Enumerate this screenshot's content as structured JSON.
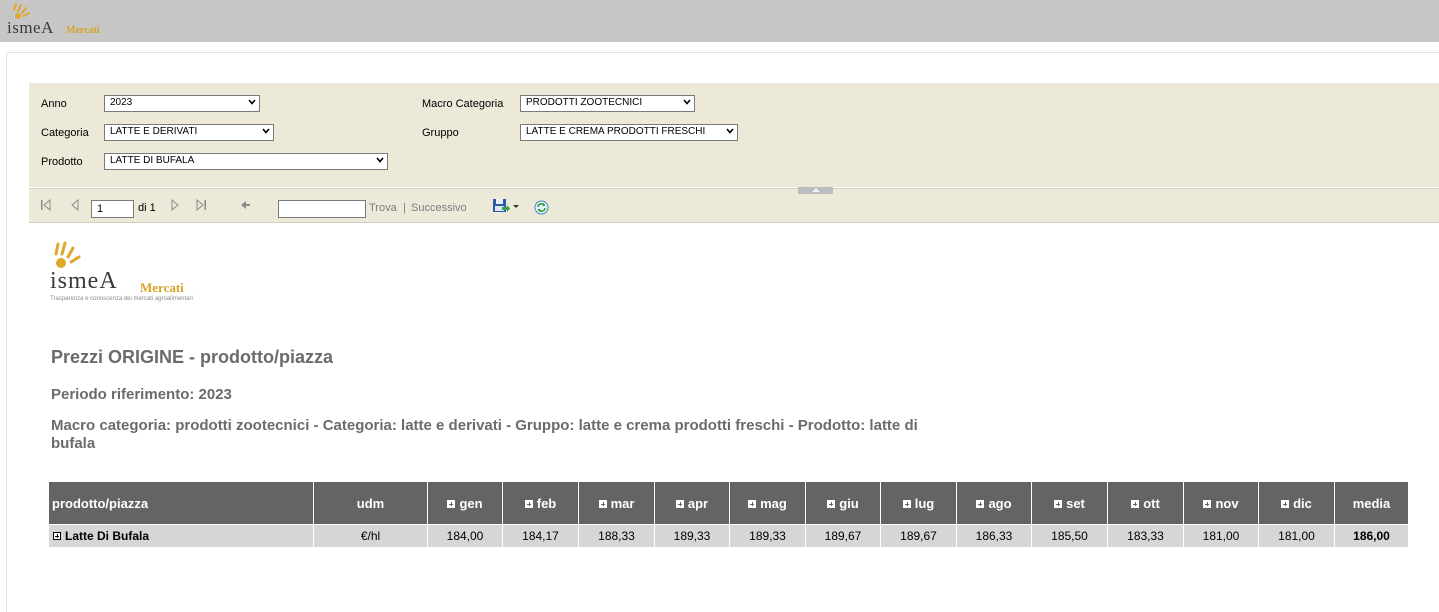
{
  "header": {
    "logo_brand": "ismeA",
    "logo_sub": "Mercati"
  },
  "params": {
    "anno_label": "Anno",
    "anno_value": "2023",
    "macro_label": "Macro Categoria",
    "macro_value": "PRODOTTI ZOOTECNICI",
    "categoria_label": "Categoria",
    "categoria_value": "LATTE E DERIVATI",
    "gruppo_label": "Gruppo",
    "gruppo_value": "LATTE E CREMA PRODOTTI FRESCHI",
    "prodotto_label": "Prodotto",
    "prodotto_value": "LATTE DI BUFALA"
  },
  "toolbar": {
    "page_value": "1",
    "page_of": "di 1",
    "find_label": "Trova",
    "separator": "|",
    "next_label": "Successivo"
  },
  "report": {
    "logo_brand": "ismeA",
    "logo_sub": "Mercati",
    "logo_tagline": "Trasparenza e conoscenza dei mercati agroalimentari",
    "title": "Prezzi ORIGINE - prodotto/piazza",
    "period": "Periodo riferimento: 2023",
    "description": "Macro categoria: prodotti zootecnici - Categoria: latte e derivati - Gruppo: latte e crema prodotti freschi - Prodotto: latte di bufala"
  },
  "table": {
    "col_product": "prodotto/piazza",
    "col_udm": "udm",
    "months": [
      "gen",
      "feb",
      "mar",
      "apr",
      "mag",
      "giu",
      "lug",
      "ago",
      "set",
      "ott",
      "nov",
      "dic"
    ],
    "col_media": "media",
    "rows": [
      {
        "product": "Latte Di Bufala",
        "udm": "€/hl",
        "values": [
          "184,00",
          "184,17",
          "188,33",
          "189,33",
          "189,33",
          "189,67",
          "189,67",
          "186,33",
          "185,50",
          "183,33",
          "181,00",
          "181,00"
        ],
        "media": "186,00"
      }
    ]
  },
  "colors": {
    "header_bar": "#c6c6c6",
    "panel": "#ece9d8",
    "table_header": "#646464",
    "table_row": "#d6d6d6",
    "title_text": "#6b6b6b",
    "brand_gold": "#d9a225"
  }
}
